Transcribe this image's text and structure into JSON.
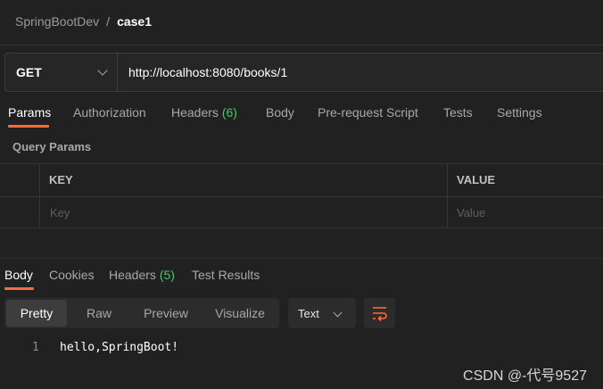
{
  "breadcrumb": {
    "workspace": "SpringBootDev",
    "separator": "/",
    "request": "case1"
  },
  "request": {
    "method": "GET",
    "url": "http://localhost:8080/books/1",
    "tabs": [
      {
        "label": "Params",
        "active": true
      },
      {
        "label": "Authorization"
      },
      {
        "label": "Headers",
        "count": "(6)"
      },
      {
        "label": "Body"
      },
      {
        "label": "Pre-request Script"
      },
      {
        "label": "Tests"
      },
      {
        "label": "Settings"
      }
    ],
    "query_params_title": "Query Params",
    "table": {
      "headers": [
        "KEY",
        "VALUE"
      ],
      "placeholders": {
        "key": "Key",
        "value": "Value"
      }
    }
  },
  "response": {
    "tabs": [
      {
        "label": "Body",
        "active": true
      },
      {
        "label": "Cookies"
      },
      {
        "label": "Headers",
        "count": "(5)"
      },
      {
        "label": "Test Results"
      }
    ],
    "formats": [
      "Pretty",
      "Raw",
      "Preview",
      "Visualize"
    ],
    "active_format": "Pretty",
    "type": "Text",
    "line_number": "1",
    "body": "hello,SpringBoot!"
  },
  "watermark": "CSDN @-代号9527",
  "colors": {
    "accent": "#ff6c37",
    "count": "#4cc46a",
    "background": "#212121"
  },
  "icons": [
    "chevron-down-icon",
    "wrap-lines-icon"
  ]
}
